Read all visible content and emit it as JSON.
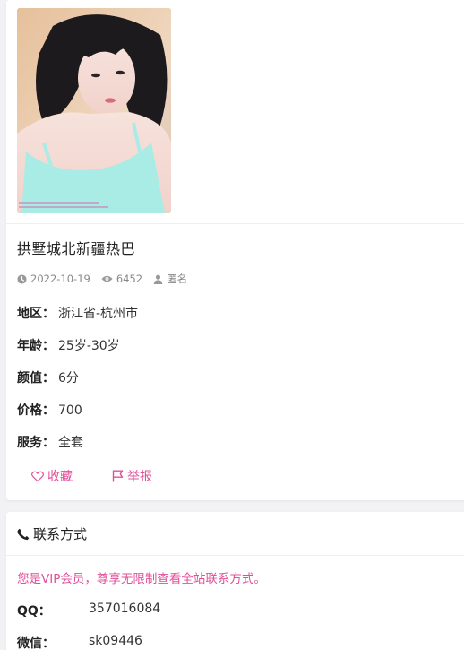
{
  "post": {
    "title": "拱墅城北新疆热巴",
    "date": "2022-10-19",
    "views": "6452",
    "author": "匿名",
    "photo_caption_line1": "...",
    "photo_caption_line2": "..."
  },
  "info": [
    {
      "label": "地区",
      "value": "浙江省-杭州市"
    },
    {
      "label": "年龄",
      "value": "25岁-30岁"
    },
    {
      "label": "颜值",
      "value": "6分"
    },
    {
      "label": "价格",
      "value": "700"
    },
    {
      "label": "服务",
      "value": "全套"
    }
  ],
  "label_separator": "：",
  "actions": {
    "favorite": "收藏",
    "report": "举报"
  },
  "contact": {
    "heading": "联系方式",
    "vip_note": "您是VIP会员，尊享无限制查看全站联系方式。",
    "rows": [
      {
        "label": "QQ：",
        "value": "357016084"
      },
      {
        "label": "微信：",
        "value": "sk09446"
      }
    ]
  },
  "colors": {
    "accent": "#e0509a",
    "page_bg": "#f2f2f4",
    "card_bg": "#ffffff"
  },
  "icons": {
    "date": "clock-icon",
    "views": "eye-icon",
    "author": "user-icon",
    "favorite": "heart-icon",
    "report": "flag-icon",
    "contact": "phone-icon"
  }
}
